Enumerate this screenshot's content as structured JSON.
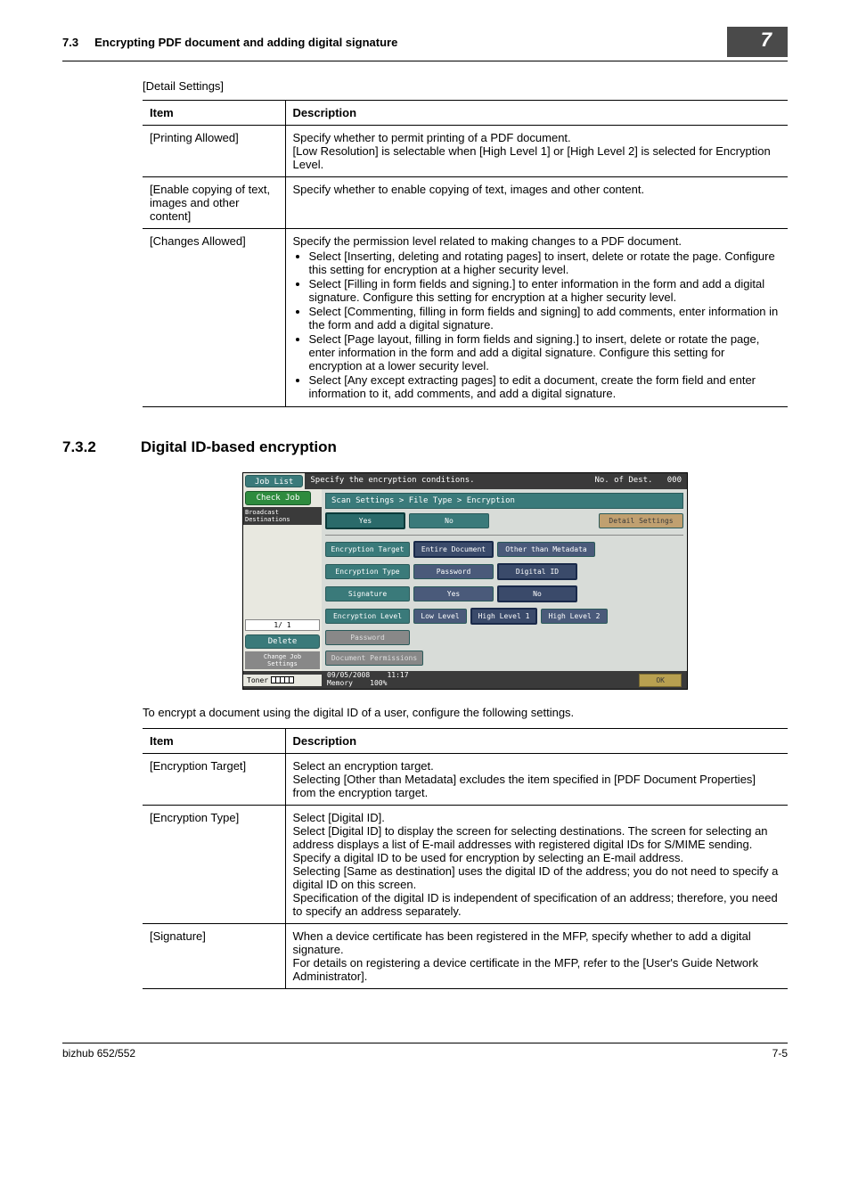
{
  "header": {
    "section_num": "7.3",
    "title": "Encrypting PDF document and adding digital signature",
    "chapter": "7"
  },
  "detail_settings_label": "[Detail Settings]",
  "table1": {
    "col_item": "Item",
    "col_desc": "Description",
    "rows": [
      {
        "item": "[Printing Allowed]",
        "desc": "Specify whether to permit printing of a PDF document.\n[Low Resolution] is selectable when [High Level 1] or [High Level 2] is selected for Encryption Level."
      },
      {
        "item": "[Enable copying of text, images and other content]",
        "desc": "Specify whether to enable copying of text, images and other content."
      },
      {
        "item": "[Changes Allowed]",
        "desc_intro": "Specify the permission level related to making changes to a PDF document.",
        "bullets": [
          "Select [Inserting, deleting and rotating pages] to insert, delete or rotate the page. Configure this setting for encryption at a higher security level.",
          "Select [Filling in form fields and signing.] to enter information in the form and add a digital signature. Configure this setting for encryption at a higher security level.",
          "Select [Commenting, filling in form fields and signing] to add comments, enter information in the form and add a digital signature.",
          "Select [Page layout, filling in form fields and signing.] to insert, delete or rotate the page, enter information in the form and add a digital signature. Configure this setting for encryption at a lower security level.",
          "Select [Any except extracting pages] to edit a document, create the form field and enter information to it, add comments, and add a digital signature."
        ]
      }
    ]
  },
  "section2": {
    "num": "7.3.2",
    "title": "Digital ID-based encryption"
  },
  "screenshot": {
    "job_list": "Job List",
    "top_text": "Specify the encryption conditions.",
    "no_of": "No. of Dest.",
    "no_of_val": "000",
    "check_job": "Check Job",
    "broadcast": "Broadcast Destinations",
    "breadcrumb": "Scan Settings > File Type > Encryption",
    "yes": "Yes",
    "no": "No",
    "detail_settings": "Detail Settings",
    "enc_target": "Encryption Target",
    "entire_doc": "Entire Document",
    "other_meta": "Other than Metadata",
    "enc_type": "Encryption Type",
    "password": "Password",
    "digital_id": "Digital ID",
    "signature": "Signature",
    "enc_level": "Encryption Level",
    "low_level": "Low Level",
    "high1": "High Level 1",
    "high2": "High Level 2",
    "pwd_btn": "Password",
    "doc_perm": "Document Permissions",
    "pager": "1/   1",
    "delete": "Delete",
    "change": "Change Job Settings",
    "toner": "Toner",
    "date": "09/05/2008",
    "time": "11:17",
    "memory": "Memory",
    "mem_pct": "100%",
    "ok": "OK"
  },
  "body_text": "To encrypt a document using the digital ID of a user, configure the following settings.",
  "table2": {
    "col_item": "Item",
    "col_desc": "Description",
    "rows": [
      {
        "item": "[Encryption Target]",
        "desc": "Select an encryption target.\nSelecting [Other than Metadata] excludes the item specified in [PDF Document Properties] from the encryption target."
      },
      {
        "item": "[Encryption Type]",
        "desc": "Select [Digital ID].\nSelect [Digital ID] to display the screen for selecting destinations. The screen for selecting an address displays a list of E-mail addresses with registered digital IDs for S/MIME sending. Specify a digital ID to be used for encryption by selecting an E-mail address.\nSelecting [Same as destination] uses the digital ID of the address; you do not need to specify a digital ID on this screen.\nSpecification of the digital ID is independent of specification of an address; therefore, you need to specify an address separately."
      },
      {
        "item": "[Signature]",
        "desc": "When a device certificate has been registered in the MFP, specify whether to add a digital signature.\nFor details on registering a device certificate in the MFP, refer to the [User's Guide Network Administrator]."
      }
    ]
  },
  "footer": {
    "left": "bizhub 652/552",
    "right": "7-5"
  }
}
